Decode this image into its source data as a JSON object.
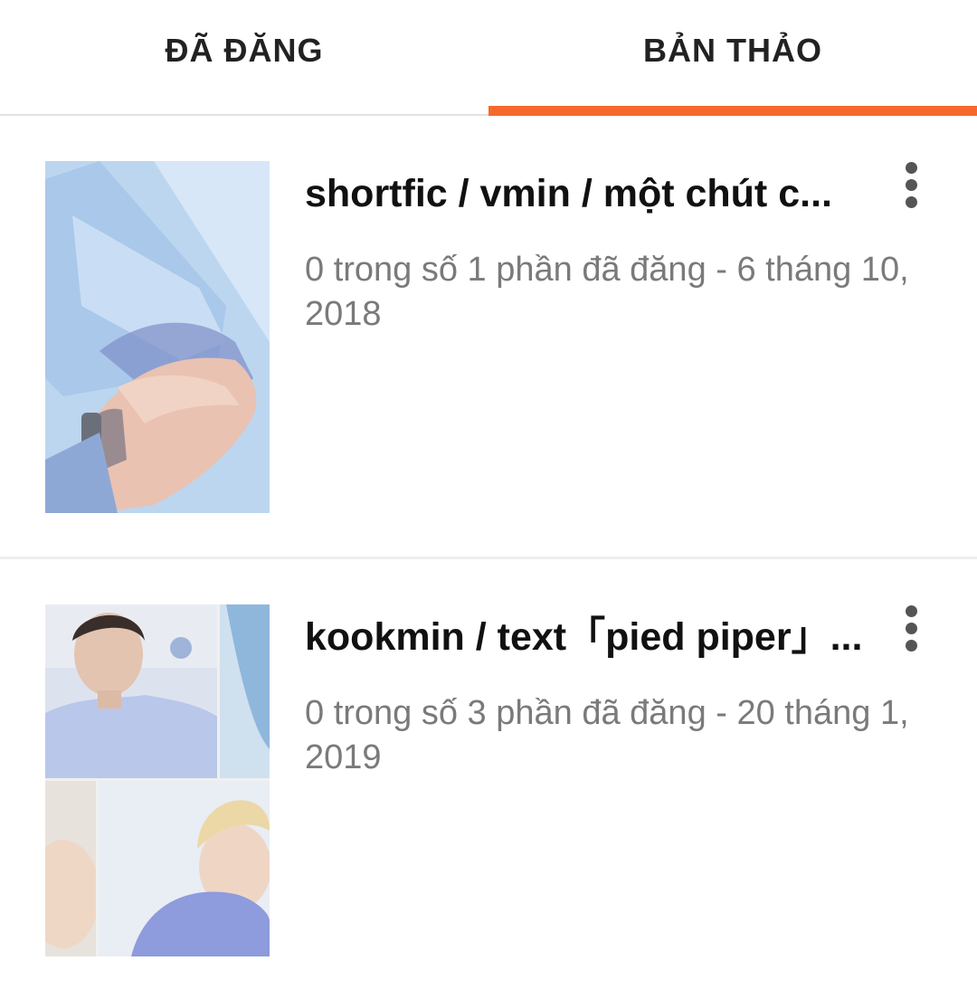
{
  "colors": {
    "accent": "#F56A2A",
    "title_text": "#111111",
    "meta_text": "#7A7A7A"
  },
  "tabs": [
    {
      "label": "ĐÃ ĐĂNG",
      "active": false
    },
    {
      "label": "BẢN THẢO",
      "active": true
    }
  ],
  "stories": [
    {
      "title": "shortfic / vmin / một chút c...",
      "meta": "0 trong số 1 phần đã đăng - 6 tháng 10, 2018",
      "menu_icon": "more-vertical-icon"
    },
    {
      "title": "kookmin / text「pied piper」...",
      "meta": "0 trong số 3 phần đã đăng - 20 tháng 1, 2019",
      "menu_icon": "more-vertical-icon"
    }
  ]
}
